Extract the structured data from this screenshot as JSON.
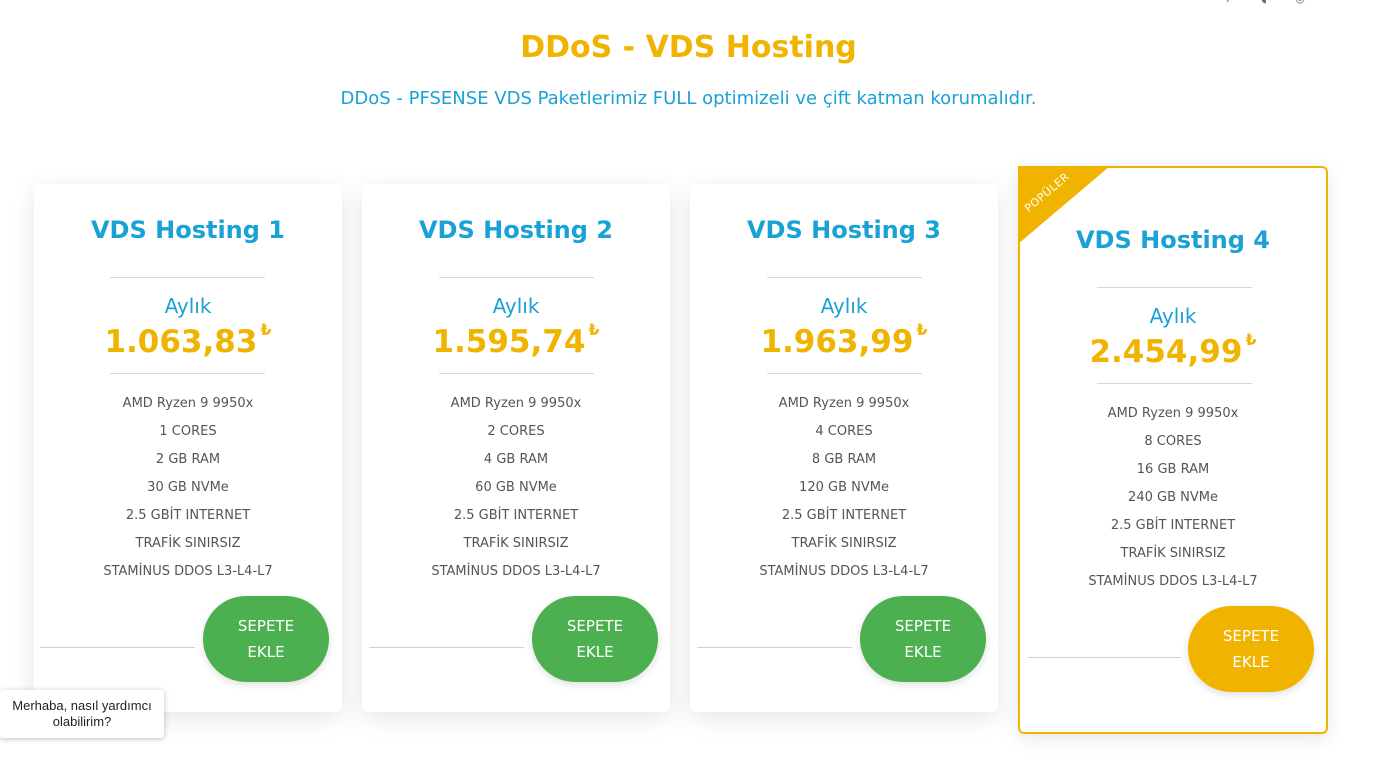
{
  "header": {
    "title": "DDoS - VDS Hosting",
    "subtitle": "DDoS - PFSENSE VDS Paketlerimiz FULL optimizeli ve çift katman korumalıdır."
  },
  "top_icons": [
    "facebook-icon",
    "twitter-icon",
    "instagram-icon",
    "grid-icon"
  ],
  "plans": [
    {
      "name": "VDS Hosting 1",
      "period": "Aylık",
      "price": "1.063,83",
      "currency": "₺",
      "features": [
        "AMD Ryzen 9 9950x",
        "1 CORES",
        "2 GB RAM",
        "30 GB NVMe",
        "2.5 GBİT INTERNET",
        "TRAFİK SINIRSIZ",
        "STAMİNUS DDOS L3-L4-L7"
      ],
      "button": "SEPETE\nEKLE",
      "popular": false
    },
    {
      "name": "VDS Hosting 2",
      "period": "Aylık",
      "price": "1.595,74",
      "currency": "₺",
      "features": [
        "AMD Ryzen 9 9950x",
        "2 CORES",
        "4 GB RAM",
        "60 GB NVMe",
        "2.5 GBİT INTERNET",
        "TRAFİK SINIRSIZ",
        "STAMİNUS DDOS L3-L4-L7"
      ],
      "button": "SEPETE\nEKLE",
      "popular": false
    },
    {
      "name": "VDS Hosting 3",
      "period": "Aylık",
      "price": "1.963,99",
      "currency": "₺",
      "features": [
        "AMD Ryzen 9 9950x",
        "4 CORES",
        "8 GB RAM",
        "120 GB NVMe",
        "2.5 GBİT INTERNET",
        "TRAFİK SINIRSIZ",
        "STAMİNUS DDOS L3-L4-L7"
      ],
      "button": "SEPETE\nEKLE",
      "popular": false
    },
    {
      "name": "VDS Hosting 4",
      "period": "Aylık",
      "price": "2.454,99",
      "currency": "₺",
      "features": [
        "AMD Ryzen 9 9950x",
        "8 CORES",
        "16 GB RAM",
        "240 GB NVMe",
        "2.5 GBİT INTERNET",
        "TRAFİK SINIRSIZ",
        "STAMİNUS DDOS L3-L4-L7"
      ],
      "button": "SEPETE\nEKLE",
      "popular": true,
      "ribbon": "POPÜLER"
    }
  ],
  "chat": {
    "text": "Merhaba, nasıl yardımcı olabilirim?"
  },
  "colors": {
    "accent": "#f0b400",
    "blue": "#1aa1d6",
    "green": "#4caf50"
  }
}
